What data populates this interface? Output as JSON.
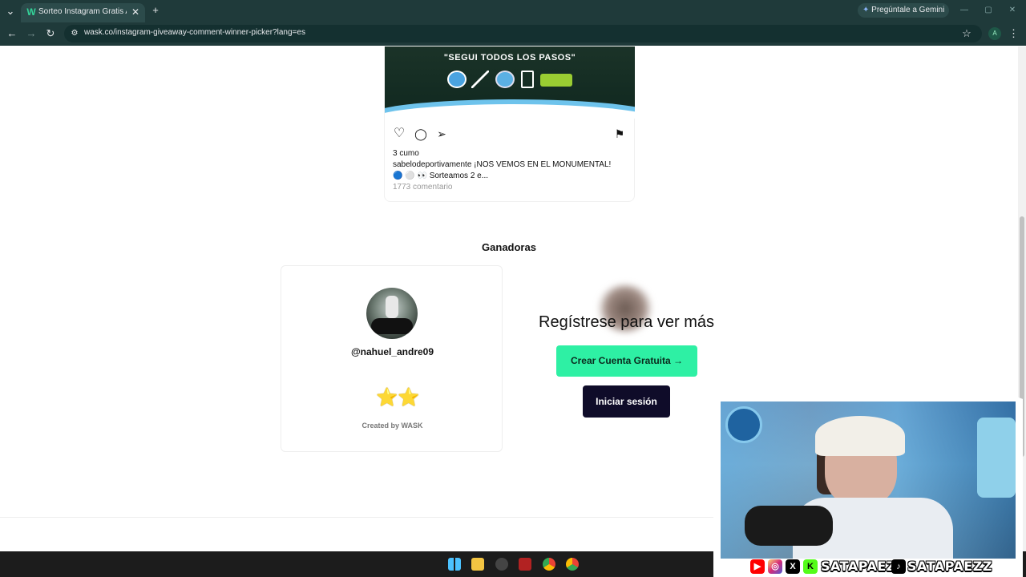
{
  "browser": {
    "tab_title": "Sorteo Instagram Gratis App - S",
    "tab_favicon": "W",
    "tab_close": "✕",
    "new_tab": "+",
    "tab_menu": "⌄",
    "gemini_label": "Pregúntale a Gemini",
    "url": "wask.co/instagram-giveaway-comment-winner-picker?lang=es",
    "profile_initial": "A",
    "window_controls": [
      "—",
      "▢",
      "✕"
    ],
    "nav": {
      "back": "←",
      "forward": "→",
      "reload": "↻",
      "bookmark": "☆",
      "menu": "⋮",
      "site_info": "⚙"
    }
  },
  "post": {
    "banner_text": "\"SEGUI TODOS LOS PASOS\"",
    "likes": "3 cumo",
    "caption_user": "sabelodeportivamente",
    "caption_text": " ¡NOS VEMOS EN EL MONUMENTAL!",
    "caption_line2": "🔵 ⚪ 👀 Sorteamos 2 e...",
    "comments": "1773 comentario",
    "icons": {
      "like": "♡",
      "comment": "◯",
      "share": "➢",
      "save": "⚑"
    }
  },
  "winners": {
    "section_title": "Ganadoras",
    "winner_username": "@nahuel_andre09",
    "stars": "⭐⭐",
    "created_by": "Created by WASK"
  },
  "register": {
    "title": "Regístrese para ver más",
    "create_button": "Crear Cuenta Gratuita →",
    "login_button": "Iniciar sesión"
  },
  "overlay": {
    "handle_1": "SATAPAEZ",
    "handle_2": "SATAPAEZZ",
    "youtube": "▶",
    "instagram": "◎",
    "x": "X",
    "kick": "K",
    "tiktok": "♪"
  },
  "colors": {
    "accent_green": "#2ef0a4",
    "dark_button": "#0f0c29",
    "browser_chrome": "#1f3a3a"
  }
}
